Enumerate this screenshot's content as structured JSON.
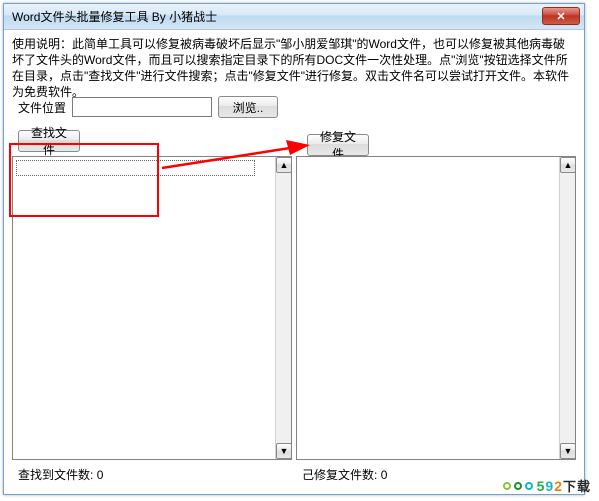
{
  "window": {
    "title": "Word文件头批量修复工具  By 小猪战士",
    "close_glyph": "✕"
  },
  "instructions": "使用说明：此简单工具可以修复被病毒破坏后显示\"邹小朋爱邹琪\"的Word文件，也可以修复被其他病毒破坏了文件头的Word文件，而且可以搜索指定目录下的所有DOC文件一次性处理。点\"浏览\"按钮选择文件所在目录，点击\"查找文件\"进行文件搜索；点击\"修复文件\"进行修复。双击文件名可以尝试打开文件。本软件为免费软件。",
  "file": {
    "label": "文件位置",
    "value": "",
    "browse_label": "浏览.."
  },
  "tabs": {
    "search_label": "查找文件",
    "repair_label": "修复文件"
  },
  "lists": {
    "found_items": [],
    "repaired_items": []
  },
  "footer": {
    "found_label": "查找到文件数:",
    "found_count": "0",
    "repaired_label": "己修复文件数:",
    "repaired_count": "0"
  },
  "scroll": {
    "up_glyph": "▲",
    "down_glyph": "▼"
  },
  "watermark": {
    "d5": "5",
    "d9": "9",
    "d2": "2",
    "suffix": "下载"
  }
}
